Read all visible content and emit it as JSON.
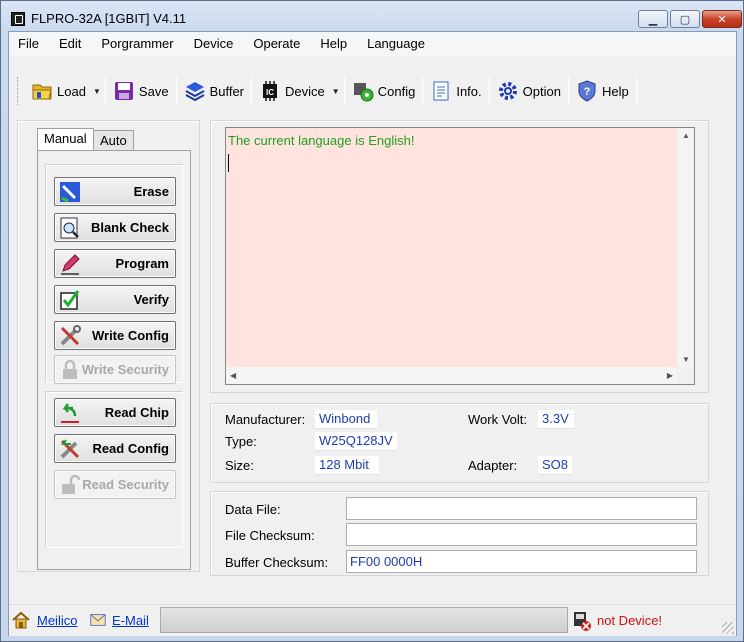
{
  "window": {
    "title": "FLPRO-32A [1GBIT] V4.11"
  },
  "menu": [
    "File",
    "Edit",
    "Porgrammer",
    "Device",
    "Operate",
    "Help",
    "Language"
  ],
  "toolbar": {
    "load": "Load",
    "save": "Save",
    "buffer": "Buffer",
    "device": "Device",
    "config": "Config",
    "info": "Info.",
    "option": "Option",
    "help": "Help"
  },
  "tabs": {
    "manual": "Manual",
    "auto": "Auto"
  },
  "actions": {
    "erase": "Erase",
    "blank_check": "Blank Check",
    "program": "Program",
    "verify": "Verify",
    "write_config": "Write Config",
    "write_security": "Write Security",
    "read_chip": "Read Chip",
    "read_config": "Read Config",
    "read_security": "Read Security"
  },
  "log": {
    "message": "The current language is English!"
  },
  "chip": {
    "manufacturer_label": "Manufacturer:",
    "manufacturer": "Winbond",
    "type_label": "Type:",
    "type": "W25Q128JV",
    "size_label": "Size:",
    "size": "128 Mbit",
    "volt_label": "Work Volt:",
    "volt": "3.3V",
    "adapter_label": "Adapter:",
    "adapter": "SO8"
  },
  "files": {
    "data_file_label": "Data File:",
    "data_file": "",
    "file_checksum_label": "File Checksum:",
    "file_checksum": "",
    "buffer_checksum_label": "Buffer Checksum:",
    "buffer_checksum": "FF00 0000H"
  },
  "statusbar": {
    "meilico": "Meilico",
    "email": "E-Mail",
    "status": "not Device!"
  },
  "colors": {
    "log_bg": "#ffe3de",
    "log_text": "#22a020",
    "value_text": "#1e3cb4",
    "status_error": "#d01010"
  }
}
